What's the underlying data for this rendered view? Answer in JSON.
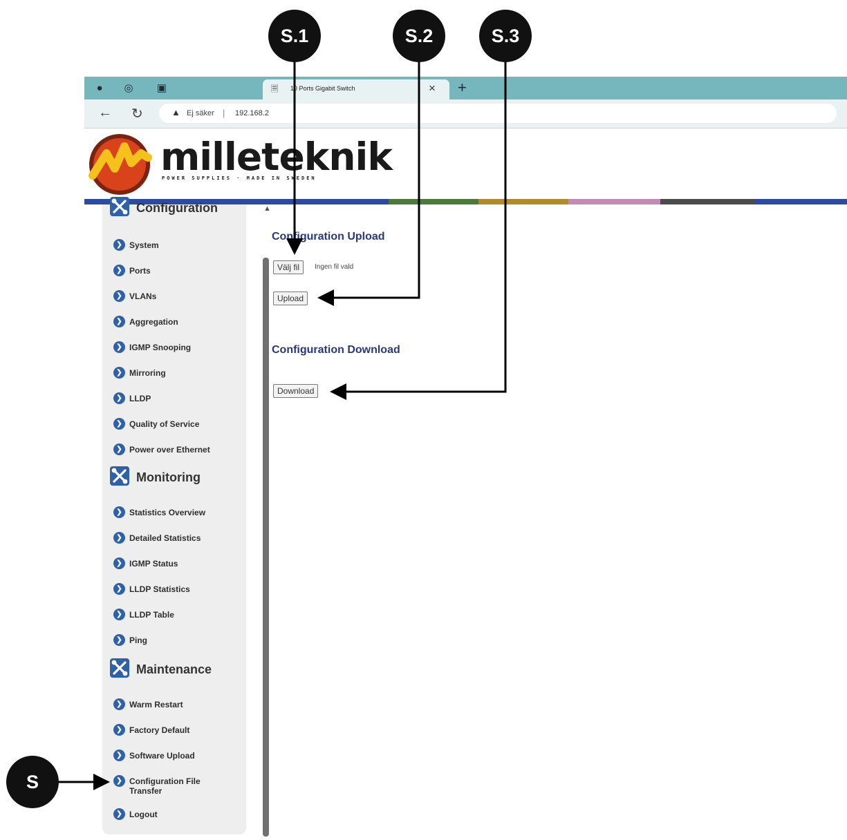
{
  "browser": {
    "tab_title": "10 Ports Gigabit Switch",
    "security_label": "Ej säker",
    "url": "192.168.2"
  },
  "header": {
    "brand": "milleteknik",
    "tagline": "POWER SUPPLIES · MADE IN SWEDEN",
    "stripe_colors": [
      "#2c4aa0",
      "#4b7a3a",
      "#b08a2b",
      "#c28ab5",
      "#4b4b4b",
      "#2c4aa0"
    ]
  },
  "sidebar": {
    "sections": [
      {
        "label": "Configuration",
        "items": [
          "System",
          "Ports",
          "VLANs",
          "Aggregation",
          "IGMP Snooping",
          "Mirroring",
          "LLDP",
          "Quality of Service",
          "Power over Ethernet"
        ]
      },
      {
        "label": "Monitoring",
        "items": [
          "Statistics Overview",
          "Detailed Statistics",
          "IGMP Status",
          "LLDP Statistics",
          "LLDP Table",
          "Ping"
        ]
      },
      {
        "label": "Maintenance",
        "items": [
          "Warm Restart",
          "Factory Default",
          "Software Upload",
          "Configuration File Transfer",
          "Logout"
        ]
      }
    ]
  },
  "main": {
    "upload_heading": "Configuration Upload",
    "choose_file_label": "Välj fil",
    "no_file_text": "Ingen fil vald",
    "upload_button": "Upload",
    "download_heading": "Configuration Download",
    "download_button": "Download"
  },
  "callouts": {
    "s": "S",
    "s1": "S.1",
    "s2": "S.2",
    "s3": "S.3"
  }
}
